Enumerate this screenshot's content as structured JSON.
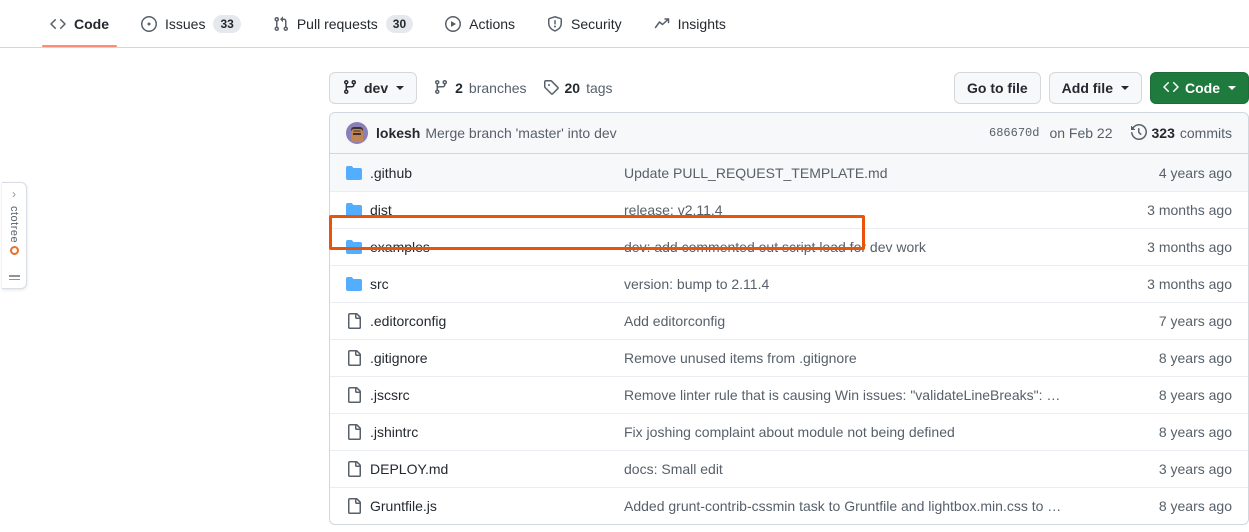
{
  "nav": {
    "items": [
      {
        "label": "Code",
        "icon": "code-icon",
        "count": null,
        "selected": true
      },
      {
        "label": "Issues",
        "icon": "issue-icon",
        "count": "33",
        "selected": false
      },
      {
        "label": "Pull requests",
        "icon": "pr-icon",
        "count": "30",
        "selected": false
      },
      {
        "label": "Actions",
        "icon": "play-icon",
        "count": null,
        "selected": false
      },
      {
        "label": "Security",
        "icon": "shield-icon",
        "count": null,
        "selected": false
      },
      {
        "label": "Insights",
        "icon": "graph-icon",
        "count": null,
        "selected": false
      }
    ]
  },
  "octotree": {
    "chevron": "›",
    "label": "ctotree",
    "logo": "octotree-logo"
  },
  "toolbar": {
    "branch_label": "dev",
    "branches_count": "2",
    "branches_label": "branches",
    "tags_count": "20",
    "tags_label": "tags",
    "go_to_file": "Go to file",
    "add_file": "Add file",
    "code_button": "Code"
  },
  "commit": {
    "author": "lokesh",
    "message": "Merge branch 'master' into dev",
    "sha": "686670d",
    "date": "on Feb 22",
    "commits_count": "323",
    "commits_label": "commits"
  },
  "files": [
    {
      "type": "folder",
      "name": ".github",
      "message": "Update PULL_REQUEST_TEMPLATE.md",
      "age": "4 years ago",
      "shaded": true,
      "highlighted": false
    },
    {
      "type": "folder",
      "name": "dist",
      "message": "release: v2.11.4",
      "age": "3 months ago",
      "shaded": false,
      "highlighted": true
    },
    {
      "type": "folder",
      "name": "examples",
      "message": "dev: add commented out script load for dev work",
      "age": "3 months ago",
      "shaded": false,
      "highlighted": false
    },
    {
      "type": "folder",
      "name": "src",
      "message": "version: bump to 2.11.4",
      "age": "3 months ago",
      "shaded": false,
      "highlighted": false
    },
    {
      "type": "file",
      "name": ".editorconfig",
      "message": "Add editorconfig",
      "age": "7 years ago",
      "shaded": false,
      "highlighted": false
    },
    {
      "type": "file",
      "name": ".gitignore",
      "message": "Remove unused items from .gitignore",
      "age": "8 years ago",
      "shaded": false,
      "highlighted": false
    },
    {
      "type": "file",
      "name": ".jscsrc",
      "message": "Remove linter rule that is causing Win issues: \"validateLineBreaks\": …",
      "age": "8 years ago",
      "shaded": false,
      "highlighted": false
    },
    {
      "type": "file",
      "name": ".jshintrc",
      "message": "Fix joshing complaint about module not being defined",
      "age": "8 years ago",
      "shaded": false,
      "highlighted": false
    },
    {
      "type": "file",
      "name": "DEPLOY.md",
      "message": "docs: Small edit",
      "age": "3 years ago",
      "shaded": false,
      "highlighted": false
    },
    {
      "type": "file",
      "name": "Gruntfile.js",
      "message": "Added grunt-contrib-cssmin task to Gruntfile and lightbox.min.css to …",
      "age": "8 years ago",
      "shaded": false,
      "highlighted": false
    }
  ],
  "colors": {
    "accent": "#0969da",
    "selected_underline": "#fd8c73",
    "code_button_green": "#1f7a3d",
    "folder_blue": "#54aeff",
    "highlight_orange": "#e8540a",
    "octotree_orange": "#e8702a"
  }
}
